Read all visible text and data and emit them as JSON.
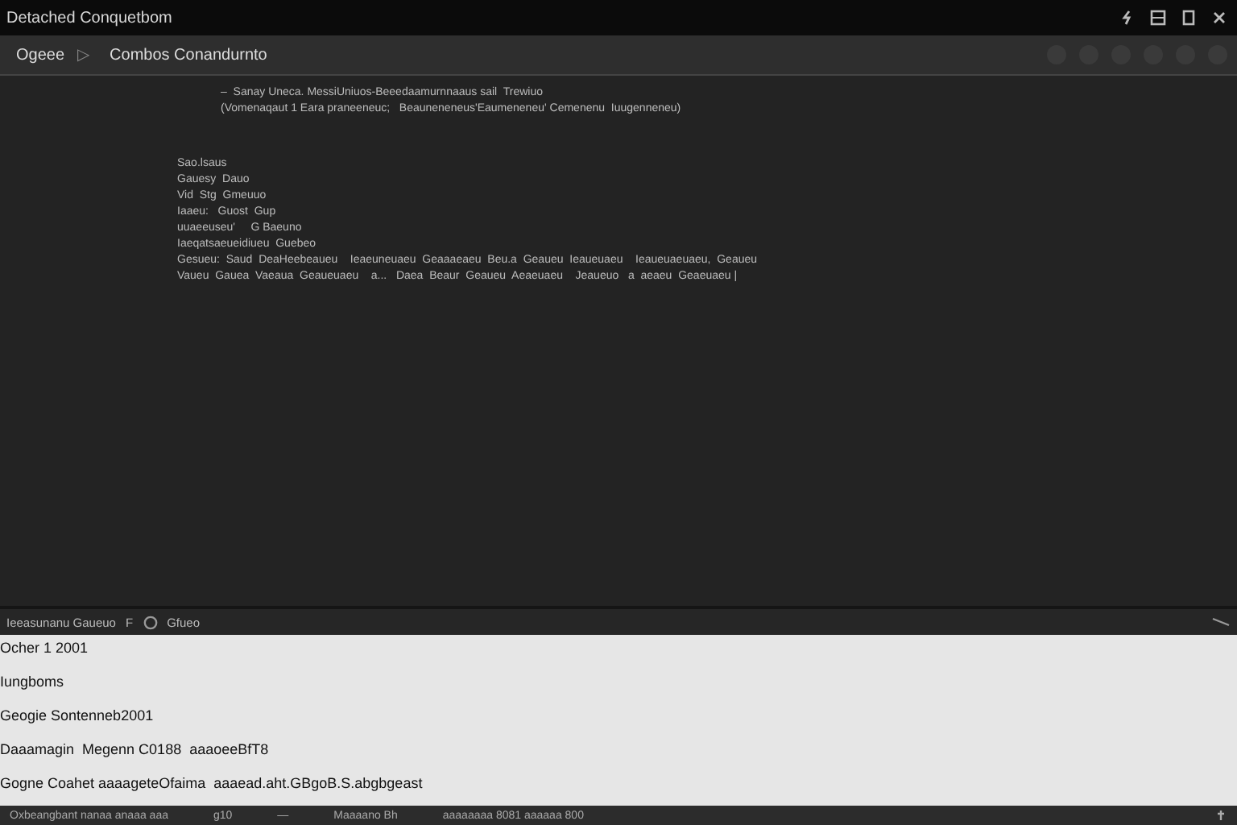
{
  "window": {
    "title": "Detached Conquetbom"
  },
  "toolbar": {
    "dropdown": "Ogeee",
    "run": "▷",
    "breadcrumb": "Combos Conandurnto"
  },
  "editor": {
    "header_lines": [
      "–  Sanay Uneca. MessiUniuos-Beeedaamurnnaaus sail  Trewiuo",
      "(Vomenaqaut 1 Eara praneeneuc;   Beauneneneus'Eaumeneneu' Cemenenu  Iuugenneneu)"
    ],
    "body_lines": [
      "Sao.lsaus",
      "Gauesy  Dauo",
      "Vid  Stg  Gmeuuo",
      "Iaaeu:   Guost  Gup",
      "uuaeeuseu'     G Baeuno",
      "Iaeqatsaeueidiueu  Guebeo",
      "Gesueu:  Saud  DeaHeebeaueu    Ieaeuneuaeu  Geaaaeaeu  Beu.a  Geaueu  Ieaueuaeu    Ieaueuaeuaeu,  Geaueu",
      "Vaueu  Gauea  Vaeaua  Geaueuaeu    a...   Daea  Beaur  Geaueu  Aeaeuaeu    Jeaueuo   a  aeaeu  Geaeuaeu |"
    ]
  },
  "panel": {
    "tab": "Ieeasunanu Gaueuo",
    "tab_marker": "F",
    "link": "Gfueo",
    "lines": [
      "Ocher 1 2001",
      "Iungboms",
      "Geogie Sontenneb2001",
      "Daaamagin  Megenn C0188  aaaoeeBfT8",
      "Gogne Coahet aaaageteOfaima  aaaead.aht.GBgoB.S.abgbgeast"
    ]
  },
  "status_bar": [
    "Oxbeangbant nanaa anaaa aaa",
    "g10",
    "—",
    "Maaaano Bh",
    "aaaaaaaa 8081 aaaaaa 800"
  ]
}
